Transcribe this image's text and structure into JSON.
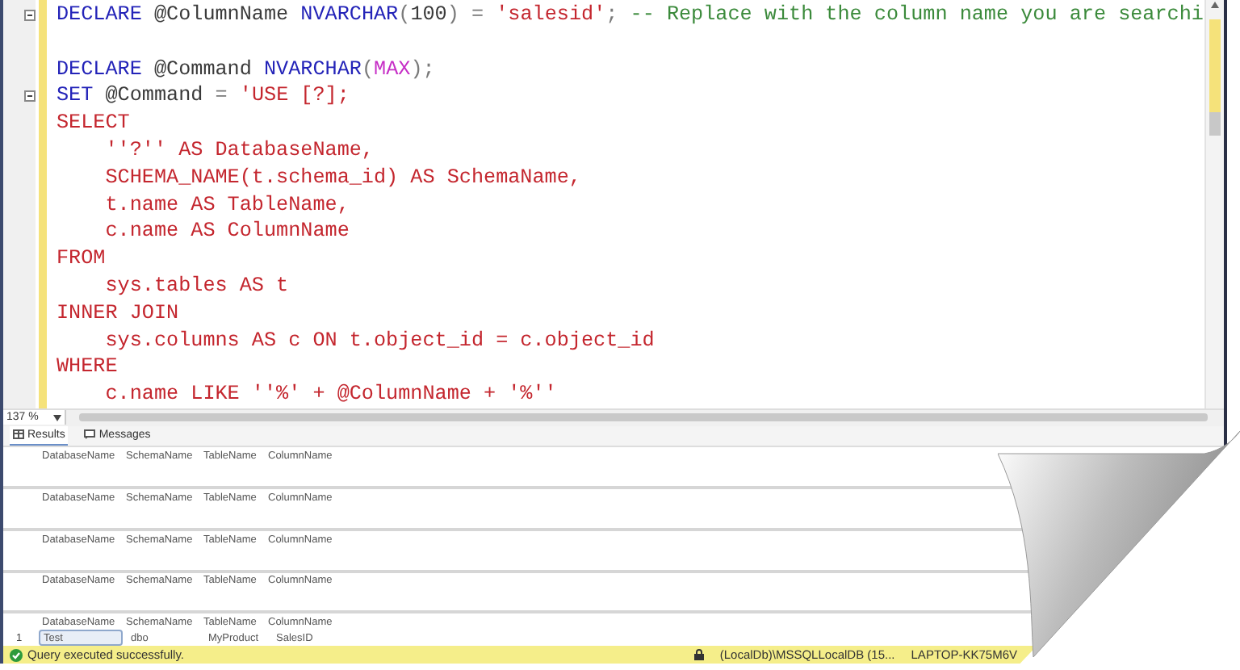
{
  "editor": {
    "lines": [
      {
        "collapsible": true,
        "tokens": [
          {
            "kind": "keyword",
            "text": "DECLARE"
          },
          {
            "kind": "plain",
            "text": " @ColumnName "
          },
          {
            "kind": "keyword",
            "text": "NVARCHAR"
          },
          {
            "kind": "operator",
            "text": "("
          },
          {
            "kind": "plain",
            "text": "100"
          },
          {
            "kind": "operator",
            "text": ") = "
          },
          {
            "kind": "string",
            "text": "'salesid'"
          },
          {
            "kind": "operator",
            "text": "; "
          },
          {
            "kind": "comment",
            "text": "-- Replace with the column name you are searchi"
          }
        ]
      },
      {
        "collapsible": false
      },
      {
        "collapsible": false,
        "tokens": [
          {
            "kind": "keyword",
            "text": "DECLARE"
          },
          {
            "kind": "plain",
            "text": " @Command "
          },
          {
            "kind": "keyword",
            "text": "NVARCHAR"
          },
          {
            "kind": "operator",
            "text": "("
          },
          {
            "kind": "function",
            "text": "MAX"
          },
          {
            "kind": "operator",
            "text": ");"
          }
        ]
      },
      {
        "collapsible": true,
        "tokens": [
          {
            "kind": "keyword",
            "text": "SET"
          },
          {
            "kind": "plain",
            "text": " @Command "
          },
          {
            "kind": "operator",
            "text": "= "
          },
          {
            "kind": "string",
            "text": "'USE [?];"
          }
        ]
      },
      {
        "collapsible": false,
        "tokens": [
          {
            "kind": "string",
            "text": "SELECT"
          }
        ]
      },
      {
        "collapsible": false,
        "tokens": [
          {
            "kind": "string",
            "text": "    ''?'' AS DatabaseName,"
          }
        ]
      },
      {
        "collapsible": false,
        "tokens": [
          {
            "kind": "string",
            "text": "    SCHEMA_NAME(t.schema_id) AS SchemaName,"
          }
        ]
      },
      {
        "collapsible": false,
        "tokens": [
          {
            "kind": "string",
            "text": "    t.name AS TableName,"
          }
        ]
      },
      {
        "collapsible": false,
        "tokens": [
          {
            "kind": "string",
            "text": "    c.name AS ColumnName"
          }
        ]
      },
      {
        "collapsible": false,
        "tokens": [
          {
            "kind": "string",
            "text": "FROM"
          }
        ]
      },
      {
        "collapsible": false,
        "tokens": [
          {
            "kind": "string",
            "text": "    sys.tables AS t"
          }
        ]
      },
      {
        "collapsible": false,
        "tokens": [
          {
            "kind": "string",
            "text": "INNER JOIN"
          }
        ]
      },
      {
        "collapsible": false,
        "tokens": [
          {
            "kind": "string",
            "text": "    sys.columns AS c ON t.object_id = c.object_id"
          }
        ]
      },
      {
        "collapsible": false,
        "tokens": [
          {
            "kind": "string",
            "text": "WHERE"
          }
        ]
      },
      {
        "collapsible": false,
        "tokens": [
          {
            "kind": "string",
            "text": "    c.name LIKE ''%' + @ColumnName + '%''"
          }
        ]
      }
    ],
    "zoom": "137 %"
  },
  "tabs": [
    {
      "label": "Results",
      "selected": true
    },
    {
      "label": "Messages",
      "selected": false
    }
  ],
  "results": [
    {
      "columns": [
        "DatabaseName",
        "SchemaName",
        "TableName",
        "ColumnName"
      ]
    },
    {
      "columns": [
        "DatabaseName",
        "SchemaName",
        "TableName",
        "ColumnName"
      ]
    },
    {
      "columns": [
        "DatabaseName",
        "SchemaName",
        "TableName",
        "ColumnName"
      ]
    },
    {
      "columns": [
        "DatabaseName",
        "SchemaName",
        "TableName",
        "ColumnName"
      ]
    },
    {
      "columns": [
        "DatabaseName",
        "SchemaName",
        "TableName",
        "ColumnName"
      ],
      "rows": [
        {
          "number": "1",
          "cells": [
            {
              "text": "Test",
              "selected": true
            },
            {
              "text": "dbo",
              "selected": false
            },
            {
              "text": "MyProduct",
              "selected": false
            },
            {
              "text": "SalesID",
              "selected": false
            }
          ]
        }
      ]
    }
  ],
  "status_bar": {
    "message": "Query executed successfully.",
    "server": "(LocalDb)\\MSSQLLocalDB (15...",
    "machine": "LAPTOP-KK75M6V"
  }
}
